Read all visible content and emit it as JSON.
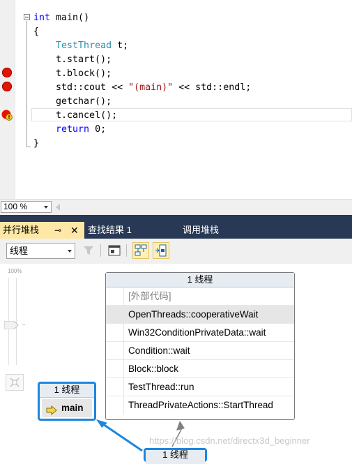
{
  "editor": {
    "lines": [
      {
        "tokens": [
          {
            "t": "int",
            "c": "kw"
          },
          {
            "t": " main()",
            "c": ""
          }
        ]
      },
      {
        "tokens": [
          {
            "t": "{",
            "c": ""
          }
        ]
      },
      {
        "tokens": [
          {
            "t": "    ",
            "c": ""
          },
          {
            "t": "TestThread",
            "c": "ty"
          },
          {
            "t": " t;",
            "c": ""
          }
        ]
      },
      {
        "tokens": [
          {
            "t": "    t.start();",
            "c": ""
          }
        ]
      },
      {
        "tokens": [
          {
            "t": "    t.block();",
            "c": ""
          }
        ]
      },
      {
        "tokens": [
          {
            "t": "    std::cout << ",
            "c": ""
          },
          {
            "t": "\"(main)\"",
            "c": "str"
          },
          {
            "t": " << std::endl;",
            "c": ""
          }
        ]
      },
      {
        "tokens": [
          {
            "t": "    getchar();",
            "c": ""
          }
        ]
      },
      {
        "tokens": [
          {
            "t": "    t.cancel();",
            "c": ""
          }
        ]
      },
      {
        "tokens": [
          {
            "t": "    ",
            "c": ""
          },
          {
            "t": "return",
            "c": "kw"
          },
          {
            "t": " 0;",
            "c": ""
          }
        ]
      },
      {
        "tokens": [
          {
            "t": "}",
            "c": ""
          }
        ]
      }
    ]
  },
  "zoom": {
    "value": "100 %"
  },
  "tabs": {
    "parallel_stacks": "并行堆栈",
    "pin": "⊸",
    "close": "✕",
    "find_results": "查找结果 1",
    "call_stack": "调用堆栈"
  },
  "toolbar": {
    "thread_select": "线程"
  },
  "canvas": {
    "zoom_pct": "100%",
    "node1": {
      "header": "1 线程",
      "frames": [
        {
          "label": "[外部代码]",
          "ext": true
        },
        {
          "label": "OpenThreads::cooperativeWait",
          "sel": true
        },
        {
          "label": "Win32ConditionPrivateData::wait"
        },
        {
          "label": "Condition::wait"
        },
        {
          "label": "Block::block"
        },
        {
          "label": "TestThread::run"
        },
        {
          "label": "ThreadPrivateActions::StartThread"
        }
      ]
    },
    "node2": {
      "header": "1 线程",
      "frame": "main"
    },
    "node3": {
      "header": "1 线程"
    }
  },
  "watermark": "https://blog.csdn.net/directx3d_beginner",
  "colors": {
    "accent": "#1c86e0",
    "tab_bar": "#293955",
    "tab_active": "#ffe8a6",
    "breakpoint": "#e51400"
  }
}
